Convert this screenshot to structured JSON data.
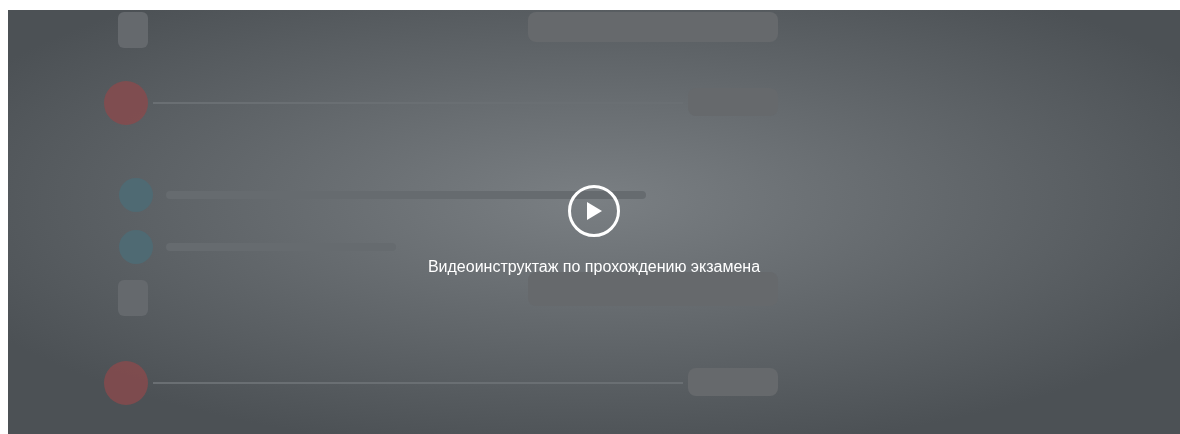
{
  "video": {
    "kind": "picture",
    "caption": "Видеоинструктаж по прохождению экзамена"
  }
}
